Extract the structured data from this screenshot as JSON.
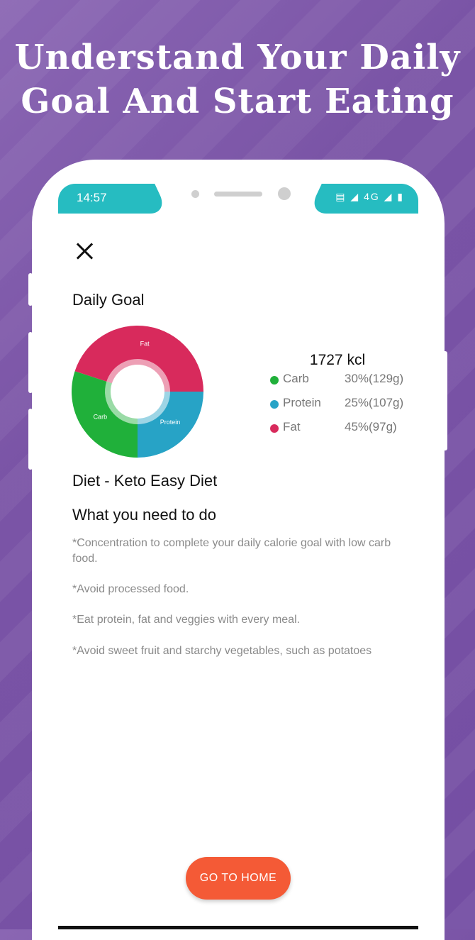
{
  "headline": {
    "line1": "Understand Your Daily",
    "line2": "Goal And Start Eating"
  },
  "status_bar": {
    "time": "14:57",
    "icons": "▤ ◢ 4G ◢ ▮"
  },
  "screen": {
    "title": "Daily Goal",
    "total": "1727 kcl",
    "legend": [
      {
        "name": "Carb",
        "value": "30%(129g)",
        "color": "#20b03a"
      },
      {
        "name": "Protein",
        "value": "25%(107g)",
        "color": "#27a3c6"
      },
      {
        "name": "Fat",
        "value": "45%(97g)",
        "color": "#d82a5c"
      }
    ],
    "diet_title": "Diet - Keto Easy Diet",
    "todo_title": "What you need to do",
    "instructions": [
      "*Concentration to complete your daily calorie goal with low carb food.",
      "*Avoid processed food.",
      "*Eat protein, fat and veggies with every meal.",
      "*Avoid sweet fruit and starchy vegetables, such as potatoes"
    ],
    "go_home_label": "GO TO HOME"
  },
  "chart_data": {
    "type": "pie",
    "categories": [
      "Fat",
      "Carb",
      "Protein"
    ],
    "values": [
      45,
      30,
      25
    ],
    "colors": [
      "#d82a5c",
      "#20b03a",
      "#27a3c6"
    ]
  }
}
